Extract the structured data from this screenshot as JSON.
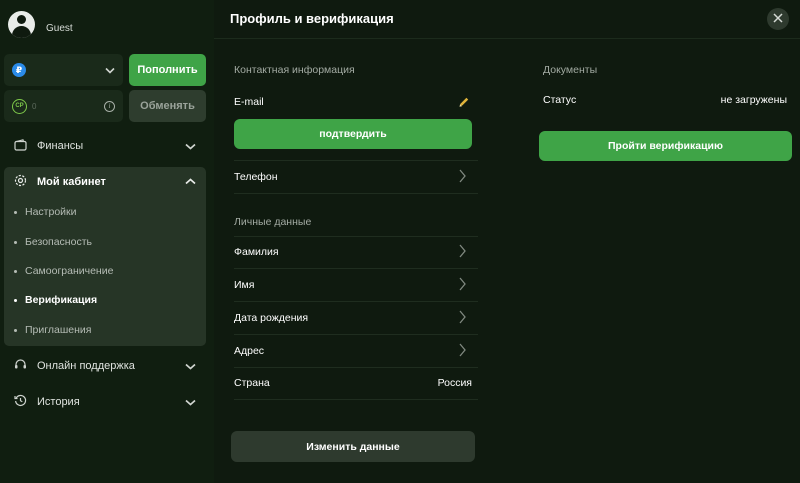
{
  "sidebar": {
    "user_name": "Guest",
    "currency_symbol": "₽",
    "deposit_label": "Пополнить",
    "points_icon_text": "CP",
    "points_value": "0",
    "exchange_label": "Обменять",
    "nav": [
      {
        "label": "Финансы",
        "icon": "wallet-icon"
      },
      {
        "label": "Мой кабинет",
        "icon": "gear-icon"
      },
      {
        "label": "Онлайн поддержка",
        "icon": "headset-icon"
      },
      {
        "label": "История",
        "icon": "history-icon"
      }
    ],
    "cabinet_items": [
      {
        "label": "Настройки"
      },
      {
        "label": "Безопасность"
      },
      {
        "label": "Самоограничение"
      },
      {
        "label": "Верификация",
        "active": true
      },
      {
        "label": "Приглашения"
      }
    ]
  },
  "main": {
    "title": "Профиль и верификация",
    "contact": {
      "section_title": "Контактная информация",
      "email_label": "E-mail",
      "confirm_label": "подтвердить",
      "phone_label": "Телефон"
    },
    "personal": {
      "section_title": "Личные данные",
      "surname_label": "Фамилия",
      "name_label": "Имя",
      "birthdate_label": "Дата рождения",
      "address_label": "Адрес",
      "country_label": "Страна",
      "country_value": "Россия"
    },
    "edit_label": "Изменить данные",
    "documents": {
      "section_title": "Документы",
      "status_label": "Статус",
      "status_value": "не загружены",
      "verify_label": "Пройти верификацию"
    }
  },
  "colors": {
    "accent": "#3fa447",
    "background": "#0f1a0f",
    "active_panel": "#263526"
  }
}
